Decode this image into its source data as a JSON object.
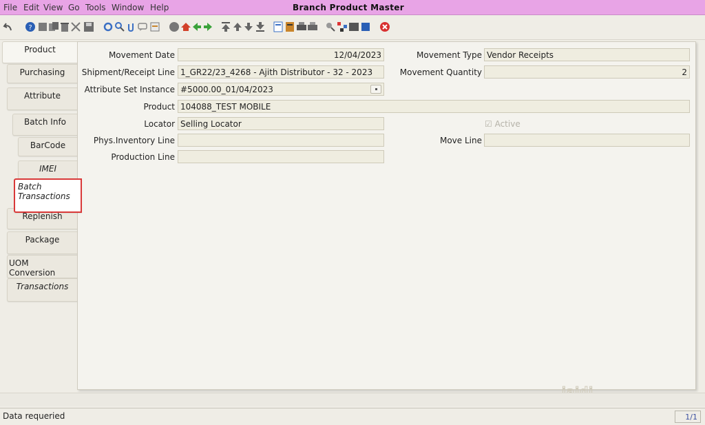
{
  "window": {
    "title": "Branch Product Master"
  },
  "menu": [
    {
      "key": "file",
      "label": "File"
    },
    {
      "key": "edit",
      "label": "Edit"
    },
    {
      "key": "view",
      "label": "View"
    },
    {
      "key": "go",
      "label": "Go"
    },
    {
      "key": "tools",
      "label": "Tools"
    },
    {
      "key": "window",
      "label": "Window"
    },
    {
      "key": "help",
      "label": "Help"
    }
  ],
  "toolbar_icons": [
    "undo-icon",
    "help-icon",
    "new-icon",
    "copy-icon",
    "delete-icon",
    "delete-selection-icon",
    "save-icon",
    "refresh-icon",
    "find-icon",
    "attachment-icon",
    "chat-icon",
    "history-icon",
    "home-icon",
    "parent-icon",
    "back-icon",
    "forward-icon",
    "first-icon",
    "previous-icon",
    "next-icon",
    "last-icon",
    "report-icon",
    "archive-icon",
    "print-icon",
    "print-preview-icon",
    "zoom-across-icon",
    "workflow-icon",
    "request-icon",
    "product-info-icon",
    "exit-icon"
  ],
  "tabs": [
    {
      "label": "Product"
    },
    {
      "label": "Purchasing"
    },
    {
      "label": "Attribute"
    },
    {
      "label": "Batch Info"
    },
    {
      "label": "BarCode"
    },
    {
      "label": "IMEI"
    },
    {
      "label": "Batch Transactions"
    },
    {
      "label": "Replenish"
    },
    {
      "label": "Package"
    },
    {
      "label": "UOM Conversion"
    },
    {
      "label": "Transactions"
    }
  ],
  "form": {
    "movement_date": {
      "label": "Movement Date",
      "value": "12/04/2023"
    },
    "shipment_line": {
      "label": "Shipment/Receipt Line",
      "value": "1_GR22/23_4268 - Ajith Distributor - 32 - 2023"
    },
    "attribute_set_instance": {
      "label": "Attribute Set Instance",
      "value": "#5000.00_01/04/2023"
    },
    "product": {
      "label": "Product",
      "value": "104088_TEST MOBILE"
    },
    "locator": {
      "label": "Locator",
      "value": "Selling Locator"
    },
    "phys_inventory_line": {
      "label": "Phys.Inventory Line",
      "value": ""
    },
    "production_line": {
      "label": "Production Line",
      "value": ""
    },
    "movement_type": {
      "label": "Movement Type",
      "value": "Vendor Receipts"
    },
    "movement_quantity": {
      "label": "Movement Quantity",
      "value": "2"
    },
    "active": {
      "label": "Active",
      "checked": true
    },
    "move_line": {
      "label": "Move Line",
      "value": ""
    }
  },
  "status": {
    "message": "Data requeried",
    "record_count": "1/1"
  },
  "logo_text": "iaidi"
}
